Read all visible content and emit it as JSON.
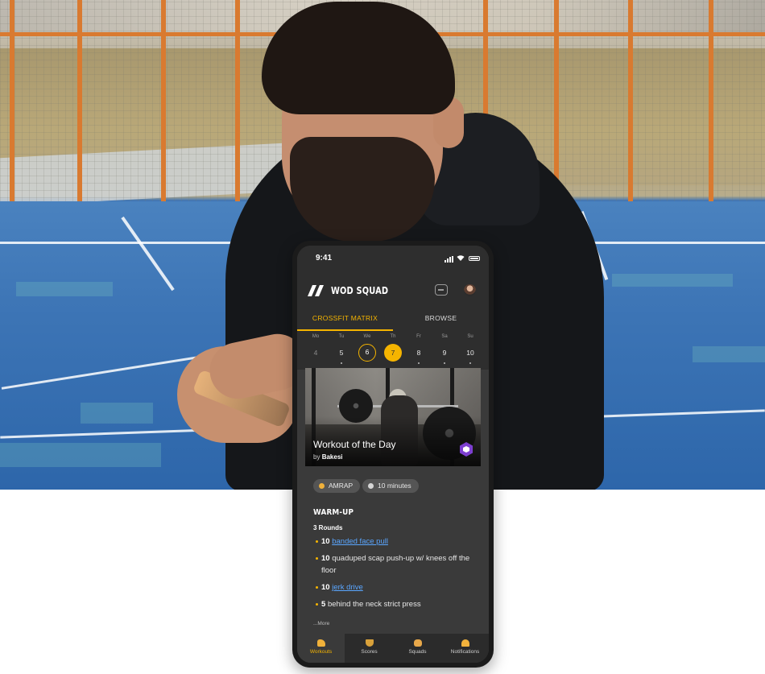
{
  "status_bar": {
    "time": "9:41"
  },
  "app": {
    "title": "WOD SQUAD"
  },
  "tabs": [
    {
      "label": "CROSSFIT MATRIX",
      "active": true
    },
    {
      "label": "BROWSE",
      "active": false
    }
  ],
  "week": [
    {
      "name": "Mo",
      "date": "4",
      "state": "muted",
      "dot": false
    },
    {
      "name": "Tu",
      "date": "5",
      "state": "normal",
      "dot": true
    },
    {
      "name": "We",
      "date": "6",
      "state": "ring",
      "dot": false
    },
    {
      "name": "Th",
      "date": "7",
      "state": "selected",
      "dot": false
    },
    {
      "name": "Fr",
      "date": "8",
      "state": "normal",
      "dot": true
    },
    {
      "name": "Sa",
      "date": "9",
      "state": "normal",
      "dot": true
    },
    {
      "name": "Su",
      "date": "10",
      "state": "normal",
      "dot": true
    }
  ],
  "workout": {
    "title": "Workout of the Day",
    "by_prefix": "by",
    "author": "Bakesi",
    "chips": [
      {
        "label": "AMRAP",
        "icon": "medal-icon"
      },
      {
        "label": "10 minutes",
        "icon": "timer-icon"
      }
    ],
    "section": "WARM-UP",
    "rounds": "3 Rounds",
    "exercises": [
      {
        "reps": "10",
        "text": "banded face pull",
        "link": true
      },
      {
        "reps": "10",
        "text": "quaduped scap push-up w/ knees off the floor",
        "link": false
      },
      {
        "reps": "10",
        "text": "jerk drive",
        "link": true
      },
      {
        "reps": "5",
        "text": "behind the neck strict press",
        "link": false
      }
    ],
    "more": "...More"
  },
  "nav": [
    {
      "label": "Workouts",
      "icon": "bicep-icon",
      "active": true
    },
    {
      "label": "Scores",
      "icon": "trophy-icon",
      "active": false
    },
    {
      "label": "Squads",
      "icon": "hand-icon",
      "active": false
    },
    {
      "label": "Notifications",
      "icon": "bell-icon",
      "active": false
    }
  ],
  "colors": {
    "accent": "#f5b400",
    "screen_bg": "#3a3a3a",
    "link": "#5aa6ff",
    "brand_badge": "#7d3fd0"
  }
}
